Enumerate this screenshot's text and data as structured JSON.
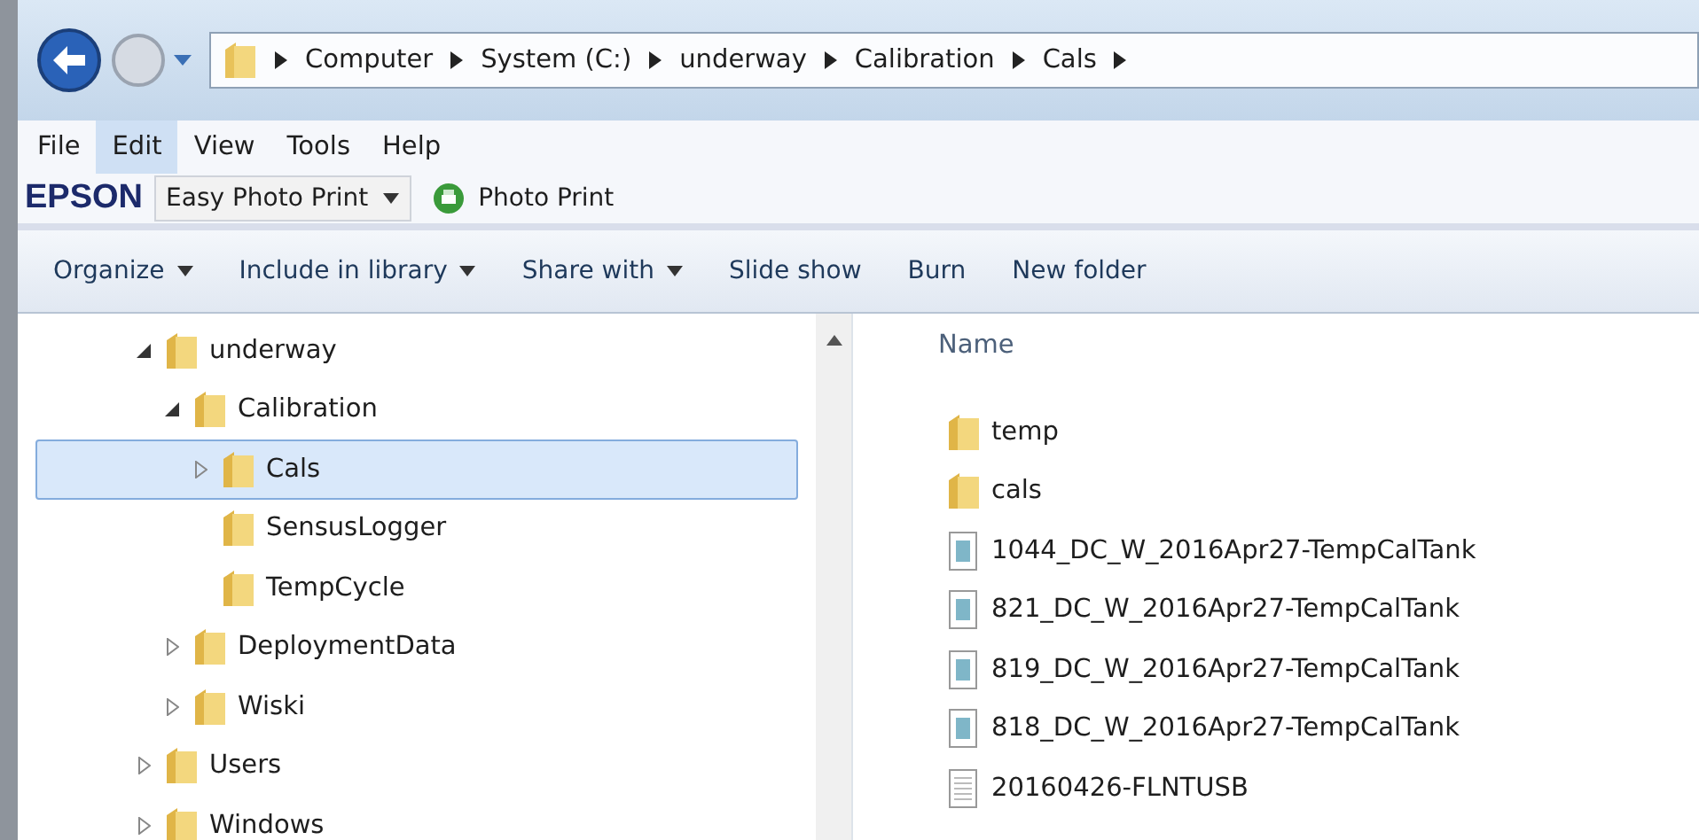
{
  "address_bar": {
    "segments": [
      "Computer",
      "System (C:)",
      "underway",
      "Calibration",
      "Cals"
    ]
  },
  "menu_bar": [
    {
      "label": "File",
      "highlighted": false
    },
    {
      "label": "Edit",
      "highlighted": true
    },
    {
      "label": "View",
      "highlighted": false
    },
    {
      "label": "Tools",
      "highlighted": false
    },
    {
      "label": "Help",
      "highlighted": false
    }
  ],
  "epson_toolbar": {
    "brand": "EPSON",
    "dropdown": "Easy Photo Print",
    "button": "Photo Print"
  },
  "command_bar": [
    {
      "label": "Organize",
      "dropdown": true
    },
    {
      "label": "Include in library",
      "dropdown": true
    },
    {
      "label": "Share with",
      "dropdown": true
    },
    {
      "label": "Slide show",
      "dropdown": false
    },
    {
      "label": "Burn",
      "dropdown": false
    },
    {
      "label": "New folder",
      "dropdown": false
    }
  ],
  "navigation_tree": [
    {
      "label": "underway",
      "expanded": true,
      "selected": false,
      "children": [
        {
          "label": "Calibration",
          "expanded": true,
          "selected": false,
          "children": [
            {
              "label": "Cals",
              "expanded": false,
              "selected": true
            },
            {
              "label": "SensusLogger",
              "selected": false
            },
            {
              "label": "TempCycle",
              "selected": false
            }
          ]
        },
        {
          "label": "DeploymentData",
          "expanded": false,
          "selected": false
        },
        {
          "label": "Wiski",
          "expanded": false,
          "selected": false
        }
      ]
    },
    {
      "label": "Users",
      "expanded": false,
      "selected": false
    },
    {
      "label": "Windows",
      "expanded": false,
      "selected": false
    }
  ],
  "file_list": {
    "column": "Name",
    "items": [
      {
        "name": "temp",
        "kind": "folder"
      },
      {
        "name": "cals",
        "kind": "folder"
      },
      {
        "name": "1044_DC_W_2016Apr27-TempCalTank",
        "kind": "data"
      },
      {
        "name": "821_DC_W_2016Apr27-TempCalTank",
        "kind": "data"
      },
      {
        "name": "819_DC_W_2016Apr27-TempCalTank",
        "kind": "data"
      },
      {
        "name": "818_DC_W_2016Apr27-TempCalTank",
        "kind": "data"
      },
      {
        "name": "20160426-FLNTUSB",
        "kind": "text"
      }
    ]
  }
}
